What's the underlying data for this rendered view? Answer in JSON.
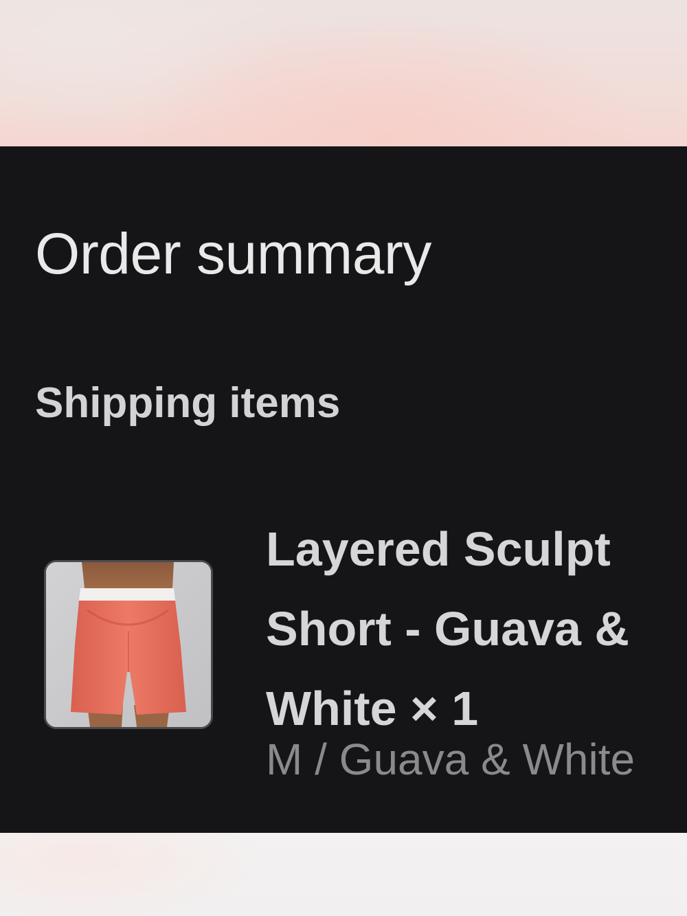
{
  "order_summary": {
    "title": "Order summary",
    "section_label": "Shipping items",
    "item": {
      "name_lines": [
        "Layered Sculpt",
        "Short - Guava &",
        "White × 1"
      ],
      "variant": "M / Guava & White",
      "thumbnail_icon": "product-shorts-image"
    }
  },
  "colors": {
    "panel_background": "#151517",
    "title_text": "#e9e9ea",
    "secondary_text": "#8a8a8e",
    "product_color": "#e46f5c"
  }
}
